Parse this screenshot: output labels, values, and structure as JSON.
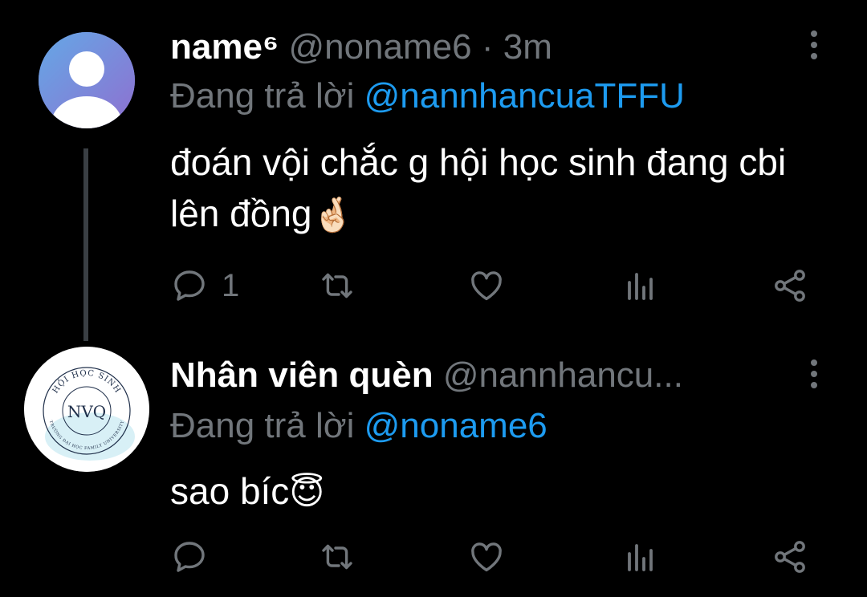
{
  "tweets": [
    {
      "display_name": "name⁶",
      "handle": "@noname6",
      "separator": "·",
      "time": "3m",
      "reply_prefix": "Đang trả lời",
      "reply_to": "@nannhancuaTFFU",
      "text": "đoán vội chắc g hội học sinh đang cbi lên đồng",
      "emoji": "🤞🏻",
      "avatar_icon": "default-user-avatar",
      "reply_count": "1",
      "icons": [
        "reply-icon",
        "retweet-icon",
        "like-icon",
        "views-icon",
        "share-icon",
        "more-icon"
      ]
    },
    {
      "display_name": "Nhân viên quèn",
      "handle": "@nannhancu...",
      "reply_prefix": "Đang trả lời",
      "reply_to": "@noname6",
      "text": "sao bíc",
      "emoji": "😇",
      "avatar": {
        "monogram": "NVQ",
        "ring_top": "HỘI HỌC SINH",
        "ring_bottom": "TRƯỜNG ĐẠI HỌC FAMILY UNIVERSITY"
      },
      "icons": [
        "reply-icon",
        "retweet-icon",
        "like-icon",
        "views-icon",
        "share-icon",
        "more-icon"
      ]
    }
  ],
  "colors": {
    "background": "#000000",
    "primary_text": "#ffffff",
    "secondary_text": "#71767b",
    "accent": "#1d9bf0",
    "thread_line": "#3a3f44"
  }
}
